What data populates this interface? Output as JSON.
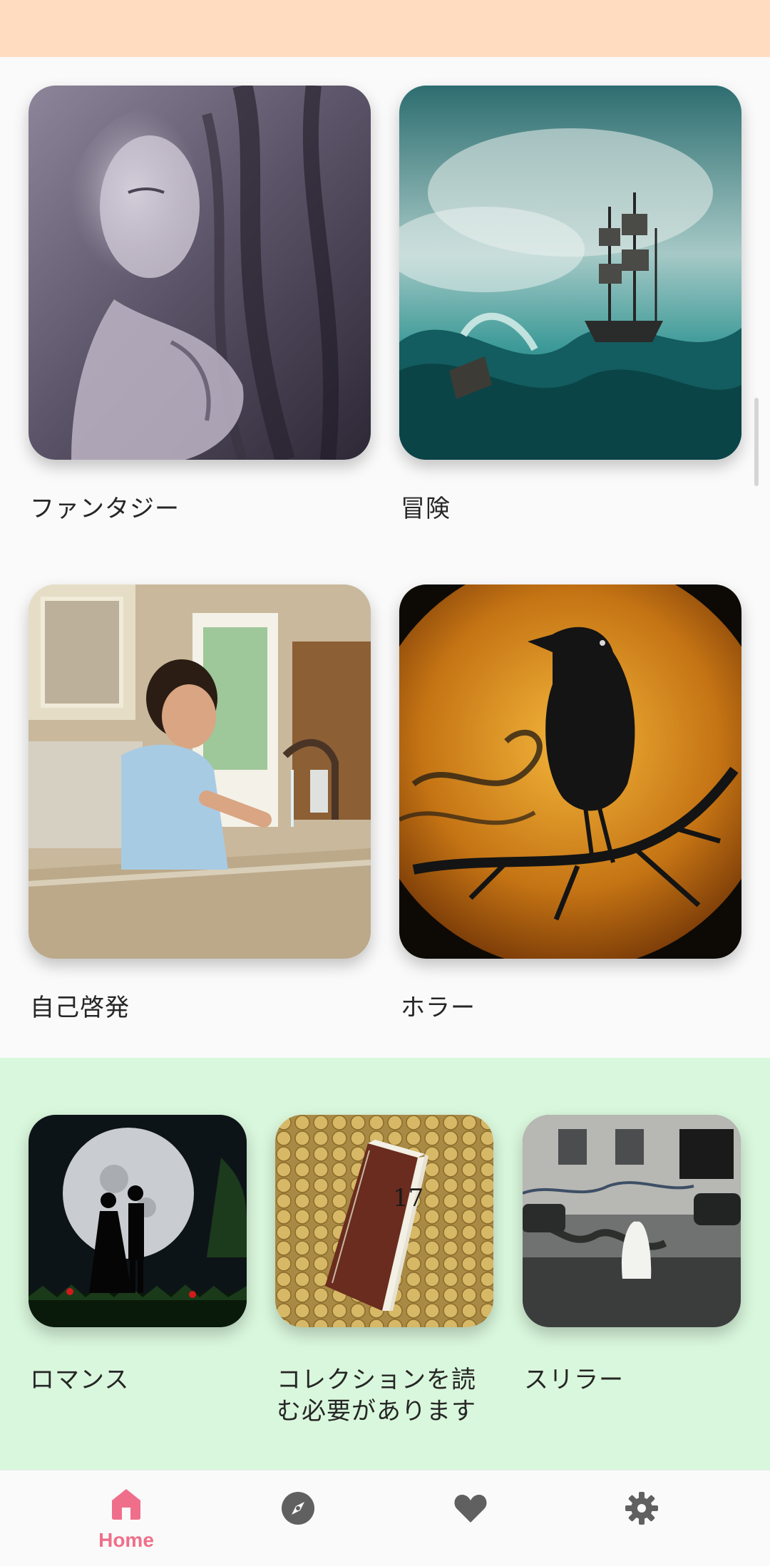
{
  "grid_large": [
    {
      "label": "ファンタジー",
      "image": "stone-woman-face-art"
    },
    {
      "label": "冒険",
      "image": "ship-in-storm"
    },
    {
      "label": "自己啓発",
      "image": "boy-washing-hands"
    },
    {
      "label": "ホラー",
      "image": "crow-on-branch-moon"
    }
  ],
  "grid_small": [
    {
      "label": "ロマンス",
      "image": "couple-silhouette-moon"
    },
    {
      "label": "コレクションを読む必要があります",
      "image": "book-on-coins"
    },
    {
      "label": "スリラー",
      "image": "ghost-by-building"
    }
  ],
  "bottom_nav": {
    "home_label": "Home",
    "items": [
      "home-icon",
      "compass-icon",
      "heart-icon",
      "gear-icon"
    ],
    "active_color": "#ef6f8a",
    "inactive_color": "#606060"
  },
  "colors": {
    "top_bar": "#ffdcc0",
    "green_section": "#d9f7dc"
  }
}
